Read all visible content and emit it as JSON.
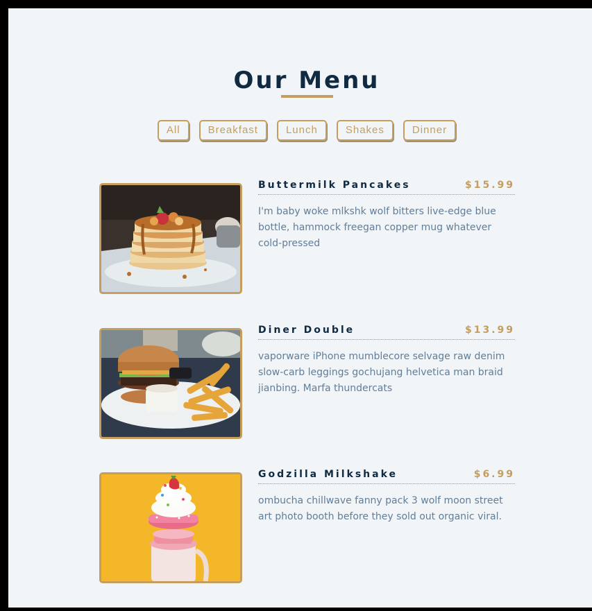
{
  "page": {
    "title": "Our Menu"
  },
  "filters": [
    "All",
    "Breakfast",
    "Lunch",
    "Shakes",
    "Dinner"
  ],
  "menu": [
    {
      "name": "Buttermilk Pancakes",
      "price": "$15.99",
      "description": "I'm baby woke mlkshk wolf bitters live-edge blue bottle, hammock freegan copper mug whatever cold-pressed",
      "image": "pancakes-photo"
    },
    {
      "name": "Diner Double",
      "price": "$13.99",
      "description": "vaporware iPhone mumblecore selvage raw denim slow-carb leggings gochujang helvetica man braid jianbing. Marfa thundercats",
      "image": "burger-photo"
    },
    {
      "name": "Godzilla Milkshake",
      "price": "$6.99",
      "description": "ombucha chillwave fanny pack 3 wolf moon street art photo booth before they sold out organic viral.",
      "image": "milkshake-photo"
    }
  ],
  "colors": {
    "gold": "#c59d5f",
    "title": "#102a42",
    "text": "#617d98",
    "background": "#f1f5f8"
  }
}
